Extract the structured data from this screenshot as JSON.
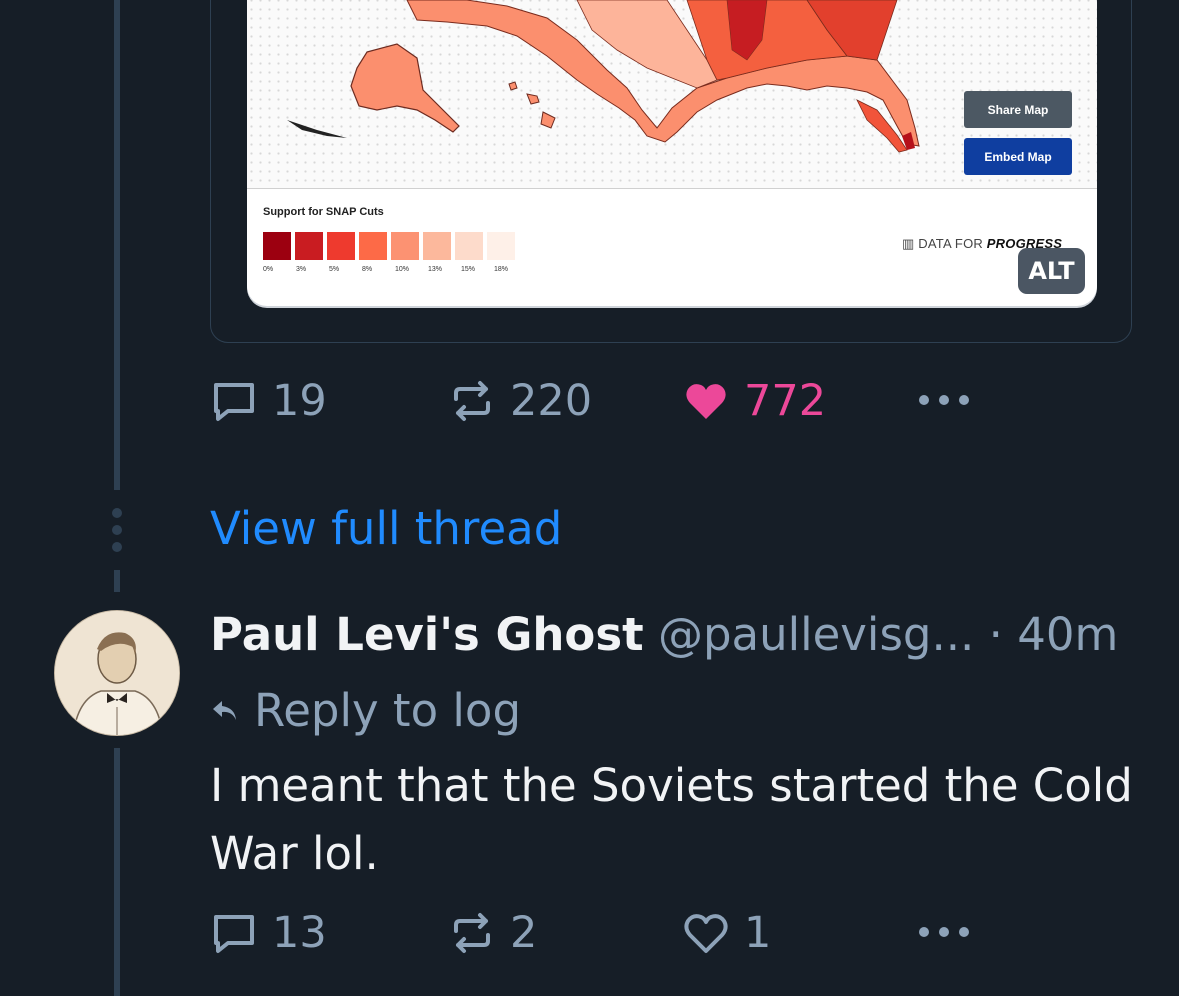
{
  "first_post": {
    "map": {
      "share_button_label": "Share Map",
      "embed_button_label": "Embed Map",
      "legend_title": "Support for SNAP Cuts",
      "legend_ticks": [
        "0%",
        "3%",
        "5%",
        "8%",
        "10%",
        "13%",
        "15%",
        "18%"
      ],
      "legend_colors": [
        "#9c0010",
        "#c91c21",
        "#ee3a2e",
        "#fd6a47",
        "#fc9272",
        "#fcb89c",
        "#fddbcb",
        "#fef0e8"
      ],
      "brand_prefix": "DATA FOR",
      "brand_emphasis": "PROGRESS",
      "alt_badge": "ALT"
    },
    "actions": {
      "replies": "19",
      "reposts": "220",
      "likes": "772"
    }
  },
  "view_full_thread": "View full thread",
  "reply_post": {
    "author_name": "Paul Levi's Ghost",
    "author_handle": "@paullevisg...",
    "time": "· 40m",
    "reply_to": "Reply to log",
    "text": "I meant that the Soviets started the Cold War lol.",
    "actions": {
      "replies": "13",
      "reposts": "2",
      "likes": "1"
    }
  },
  "colors": {
    "background": "#161e27",
    "link": "#208bfe",
    "muted": "#8da2b8",
    "like_active": "#ec4899",
    "thread_line": "#2e4052"
  }
}
